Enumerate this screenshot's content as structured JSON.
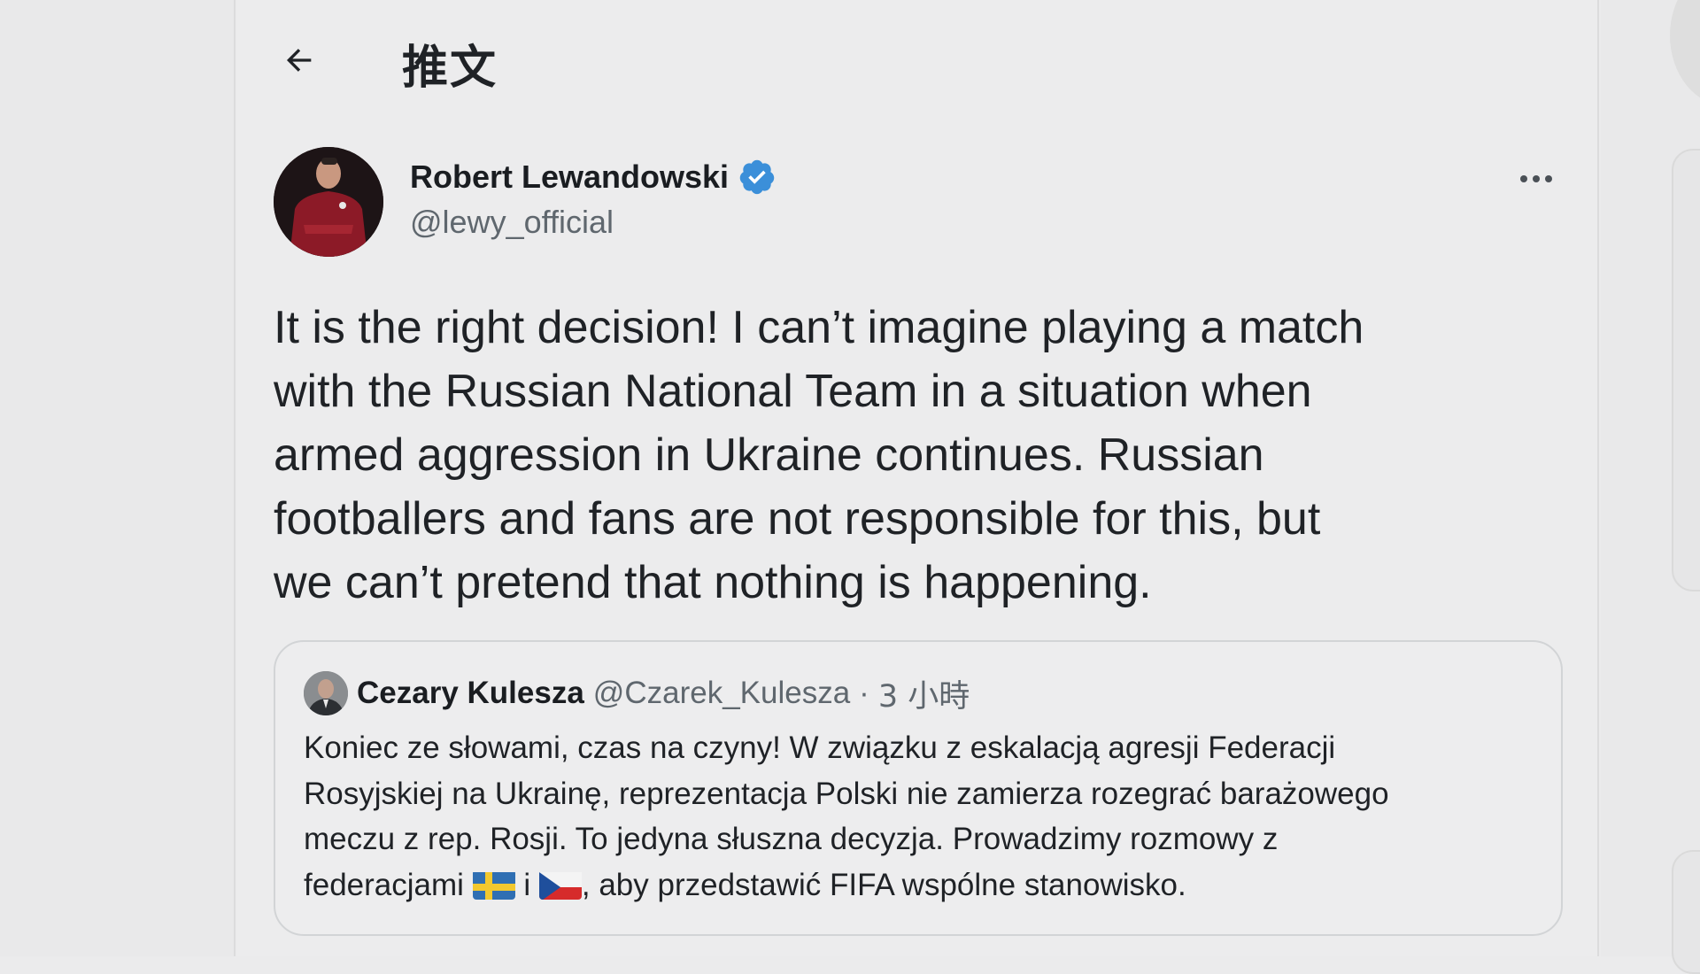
{
  "header": {
    "title": "推文",
    "back_icon": "arrow-left-icon"
  },
  "tweet": {
    "author_name": "Robert Lewandowski",
    "author_handle": "@lewy_official",
    "verified": true,
    "text_lines": [
      "It is the right decision!  I can’t imagine playing a match",
      "with the Russian National Team in a situation when",
      "armed aggression in Ukraine continues.  Russian",
      "footballers and fans are not responsible for this, but",
      "we can’t pretend that nothing is happening."
    ]
  },
  "quote": {
    "author_name": "Cezary Kulesza",
    "author_handle": "@Czarek_Kulesza",
    "separator": "·",
    "time": "3 小時",
    "text_lines": [
      "Koniec ze słowami, czas na czyny! W związku z eskalacją agresji Federacji",
      "Rosyjskiej na Ukrainę, reprezentacja Polski nie zamierza rozegrać barażowego",
      "meczu z rep. Rosji. To jedyna słuszna decyzja. Prowadzimy rozmowy z"
    ],
    "last_line_start": "federacjami ",
    "last_line_mid": " i ",
    "last_line_end": ", aby przedstawić FIFA wspólne stanowisko.",
    "flag_1": "sweden-flag-icon",
    "flag_2": "czech-flag-icon"
  },
  "colors": {
    "verified_badge": "#3b8fd9",
    "page_background": "#ececed",
    "muted_text": "#5f676e"
  }
}
